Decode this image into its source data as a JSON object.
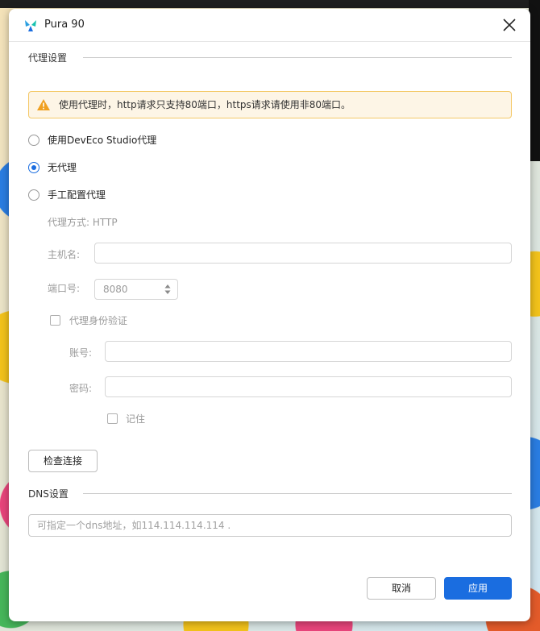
{
  "window": {
    "title": "Pura 90",
    "logo_icon": "app-logo-icon",
    "close_icon": "close-icon"
  },
  "proxy_section": {
    "heading": "代理设置",
    "warning": "使用代理时，http请求只支持80端口，https请求请使用非80端口。",
    "options": [
      {
        "label": "使用DevEco Studio代理",
        "selected": false
      },
      {
        "label": "无代理",
        "selected": true
      },
      {
        "label": "手工配置代理",
        "selected": false
      }
    ],
    "proxy_type": "代理方式:  HTTP",
    "host_label": "主机名:",
    "host_value": "",
    "port_label": "端口号:",
    "port_value": "8080",
    "auth_label": "代理身份验证",
    "auth_checked": false,
    "account_label": "账号:",
    "password_label": "密码:",
    "remember_label": "记住",
    "remember_checked": false,
    "check_button": "检查连接"
  },
  "dns_section": {
    "heading": "DNS设置",
    "placeholder": "可指定一个dns地址，如114.114.114.114 ."
  },
  "footer": {
    "cancel_label": "取消",
    "apply_label": "应用"
  },
  "colors": {
    "accent": "#1a6de0",
    "warning_bg": "#fdf5e6",
    "warning_border": "#f4c968",
    "warning_icon": "#f0a020"
  }
}
